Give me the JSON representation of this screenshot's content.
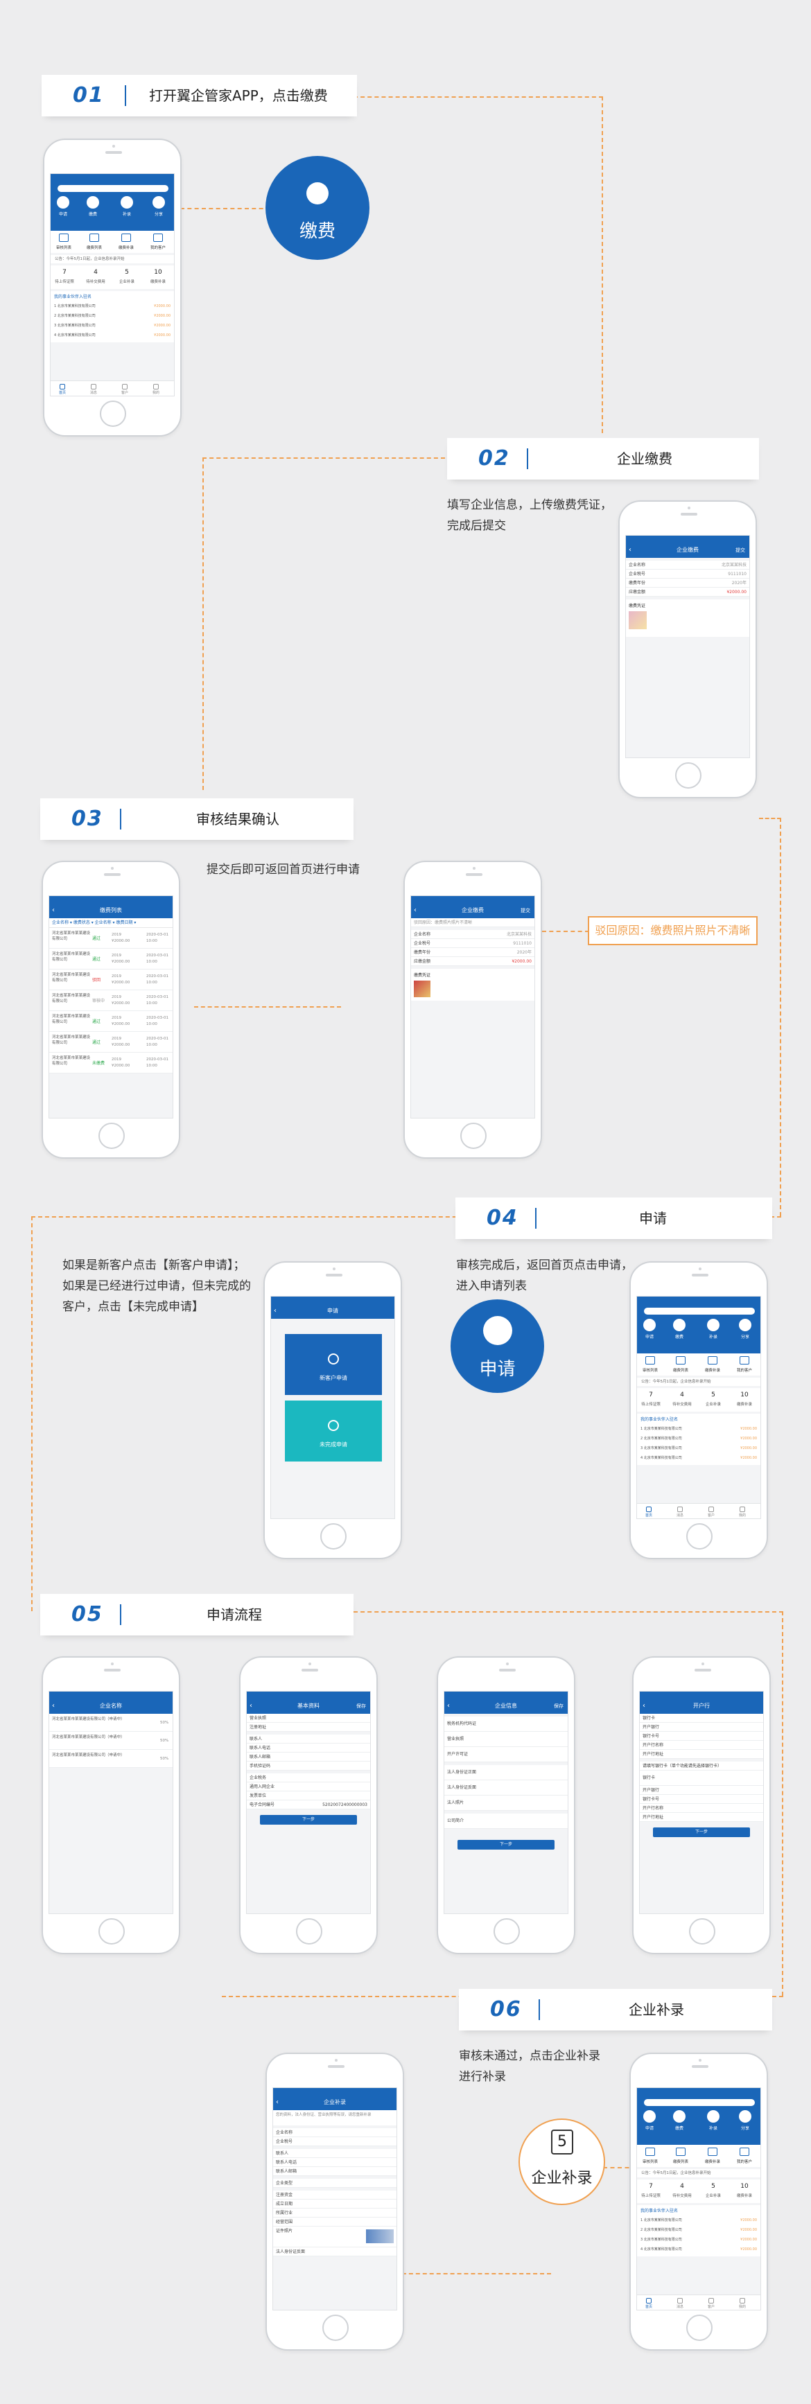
{
  "colors": {
    "brand_blue": "#1a66b8",
    "accent_orange": "#f0a050",
    "reject_red": "#e23b3b",
    "teal": "#1bb8c0"
  },
  "s1": {
    "num": "01",
    "title": "打开翼企管家APP，点击缴费",
    "circle_label": "缴费"
  },
  "s2": {
    "num": "02",
    "title": "企业缴费",
    "desc": [
      "填写企业信息，上传缴费凭证，",
      "完成后提交"
    ]
  },
  "s3": {
    "num": "03",
    "title": "审核结果确认",
    "desc": "提交后即可返回首页进行申请",
    "reject_note": "驳回原因：缴费照片照片不清晰"
  },
  "s4": {
    "num": "04",
    "title": "申请",
    "desc_left": [
      "如果是新客户点击【新客户申请】；",
      "如果是已经进行过申请，但未完成的",
      "客户，点击【未完成申请】"
    ],
    "desc_right": [
      "审核完成后，返回首页点击申请，",
      "进入申请列表"
    ],
    "circle_label": "申请"
  },
  "s5": {
    "num": "05",
    "title": "申请流程"
  },
  "s6": {
    "num": "06",
    "title": "企业补录",
    "desc": [
      "审核未通过，点击企业补录",
      "进行补录"
    ],
    "circle_num": "5",
    "circle_label": "企业补录"
  },
  "home": {
    "menu": [
      "申请",
      "缴费",
      "补录",
      "分享"
    ],
    "grid": [
      "审核列表",
      "缴费列表",
      "缴费补录",
      "我的客户"
    ],
    "notice": "公告：今年5月1日起，企业信息补录开始",
    "stats": [
      {
        "v": "7",
        "l": "待上传证照"
      },
      {
        "v": "4",
        "l": "待补交费用"
      },
      {
        "v": "5",
        "l": "企业补录"
      },
      {
        "v": "10",
        "l": "缴费补录"
      }
    ],
    "hot_title": "我的事业伙伴入驻名",
    "hot": [
      {
        "n": "1",
        "name": "北京市某某科技有限公司",
        "v": "¥2000.00"
      },
      {
        "n": "2",
        "name": "北京市某某科技有限公司",
        "v": "¥2000.00"
      },
      {
        "n": "3",
        "name": "北京市某某科技有限公司",
        "v": "¥2000.00"
      },
      {
        "n": "4",
        "name": "北京市某某科技有限公司",
        "v": "¥2000.00"
      }
    ],
    "tabs": [
      "首页",
      "消息",
      "客户",
      "我的"
    ]
  },
  "pay": {
    "title": "企业缴费",
    "right": "提交",
    "rows": [
      {
        "l": "企业名称",
        "v": "北京某某科技"
      },
      {
        "l": "企业税号",
        "v": "9111010"
      },
      {
        "l": "缴费年份",
        "v": "2020年"
      },
      {
        "l": "应缴金额",
        "v": "¥2000.00"
      }
    ],
    "proof": "缴费凭证"
  },
  "audit": {
    "title": "缴费列表",
    "tabs": "企业名称 ▾   缴费状态 ▾   企业名称 ▾   缴费日期 ▾",
    "rows": [
      {
        "name": "河北省某某市某某建设有限公司",
        "status": "通过",
        "amount": "2019\n¥2000.00",
        "date": "2020-03-01\n10:00"
      },
      {
        "name": "河北省某某市某某建设有限公司",
        "status": "通过",
        "amount": "2019\n¥2000.00",
        "date": "2020-03-01\n10:00"
      },
      {
        "name": "河北省某某市某某建设有限公司",
        "status": "驳回",
        "amount": "2019\n¥2000.00",
        "date": "2020-03-01\n10:00"
      },
      {
        "name": "河北省某某市某某建设有限公司",
        "status": "审核中",
        "amount": "2019\n¥2000.00",
        "date": "2020-03-01\n10:00"
      },
      {
        "name": "河北省某某市某某建设有限公司",
        "status": "通过",
        "amount": "2019\n¥2000.00",
        "date": "2020-03-01\n10:00"
      },
      {
        "name": "河北省某某市某某建设有限公司",
        "status": "通过",
        "amount": "2019\n¥2000.00",
        "date": "2020-03-01\n10:00"
      },
      {
        "name": "河北省某某市某某建设有限公司",
        "status": "未缴费",
        "amount": "2019\n¥2000.00",
        "date": "2020-03-01\n10:00"
      }
    ]
  },
  "detail": {
    "title": "企业缴费",
    "right": "提交",
    "reason": "驳回原因：缴费照片照片不清晰"
  },
  "apply": {
    "title": "申请",
    "new": "新客户申请",
    "unfinished": "未完成申请"
  },
  "flow": {
    "list": {
      "title": "企业名称",
      "rows": [
        {
          "n": "河北省某某市某某建设有限公司（申请中）",
          "p": "50%"
        },
        {
          "n": "河北省某某市某某建设有限公司（申请中）",
          "p": "50%"
        },
        {
          "n": "河北省某某市某某建设有限公司（申请中）",
          "p": "50%"
        }
      ]
    },
    "basic": {
      "title": "基本资料",
      "right": "保存",
      "rows": [
        "营业执照",
        "注册地址",
        "联系人",
        "联系人电话",
        "联系人邮箱",
        "手机验证码",
        "企业税务",
        "通用入网企业",
        "发票单位",
        "电子合同编号"
      ],
      "contract": "52020072400000003",
      "btn": "下一步"
    },
    "corp": {
      "title": "企业信息",
      "right": "保存",
      "rows": [
        "税务机构代码证",
        "营业执照",
        "开户许可证",
        "法人身份证正面",
        "法人身份证反面",
        "法人照片",
        "公司简介"
      ],
      "btn": "下一步"
    },
    "bank": {
      "title": "开户行",
      "right": "",
      "rows": [
        "银行卡",
        "开户银行",
        "银行卡号",
        "开户行名称",
        "开户行地址"
      ],
      "section": "请填写银行卡（单个功能请先选择银行卡）",
      "rows2": [
        "银行卡",
        "开户银行",
        "银行卡号",
        "开户行名称",
        "开户行地址"
      ],
      "btn": "下一步"
    }
  },
  "supp": {
    "title": "企业补录",
    "note": "您的资料，法人身份证、营业执照等有误，请您重新补录",
    "rows": [
      "企业名称",
      "企业税号",
      "联系人",
      "联系人电话",
      "联系人邮箱",
      "企业类型",
      "注册资金",
      "成立日期",
      "所属行业",
      "经营范围",
      "证件照片",
      "法人身份证反面"
    ],
    "btn": "提交"
  }
}
